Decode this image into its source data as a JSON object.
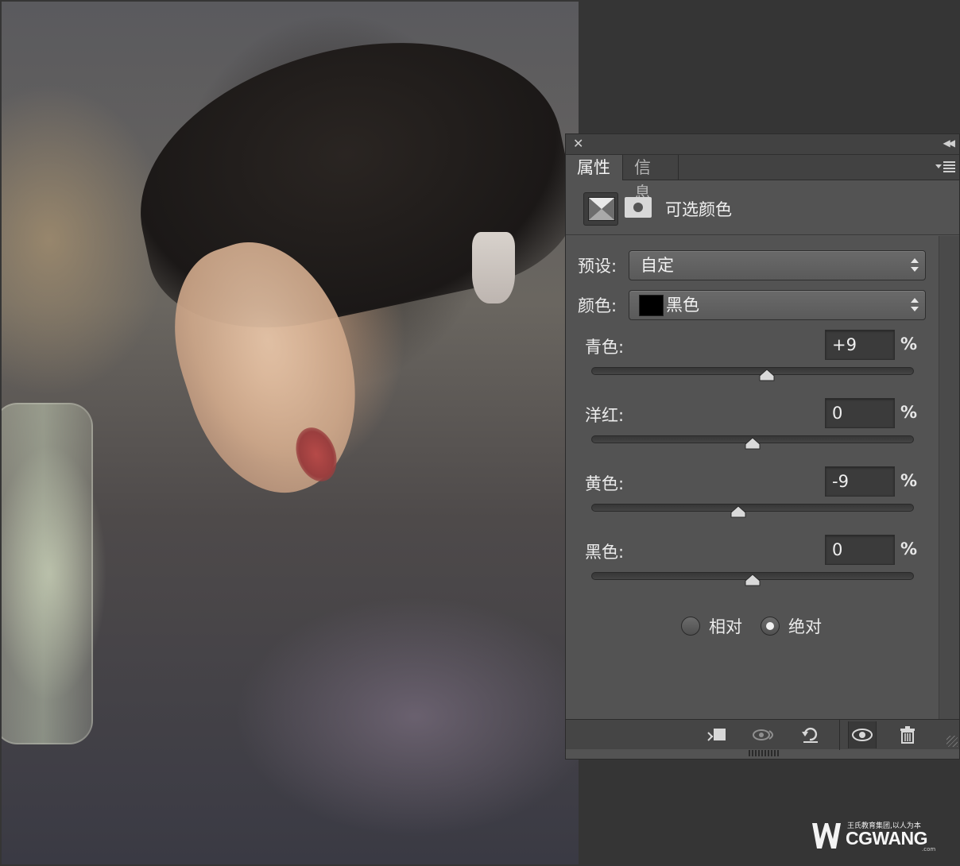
{
  "panel": {
    "tabs": [
      {
        "label": "属性"
      },
      {
        "label": "信息"
      }
    ],
    "adjustment_title": "可选颜色",
    "preset": {
      "label": "预设:",
      "value": "自定"
    },
    "colors": {
      "label": "颜色:",
      "value": "黑色",
      "swatch": "#000000"
    },
    "sliders": [
      {
        "label": "青色:",
        "value": "+9",
        "unit": "%",
        "level": 9
      },
      {
        "label": "洋红:",
        "value": "0",
        "unit": "%",
        "level": 0
      },
      {
        "label": "黄色:",
        "value": "-9",
        "unit": "%",
        "level": -9
      },
      {
        "label": "黑色:",
        "value": "0",
        "unit": "%",
        "level": 0
      }
    ],
    "method": {
      "options": [
        {
          "label": "相对",
          "checked": false
        },
        {
          "label": "绝对",
          "checked": true
        }
      ]
    },
    "footer_icons": [
      "clip-to-layer-icon",
      "view-previous-state-icon",
      "reset-icon",
      "visibility-eye-icon",
      "trash-icon"
    ]
  },
  "watermark": {
    "tagline": "王氏教育集团,以人为本",
    "brand": "CGWANG",
    "suffix": ".com"
  },
  "colors": {
    "panel_bg": "#535353",
    "app_bg": "#353535",
    "tab_bar_bg": "#424242"
  }
}
